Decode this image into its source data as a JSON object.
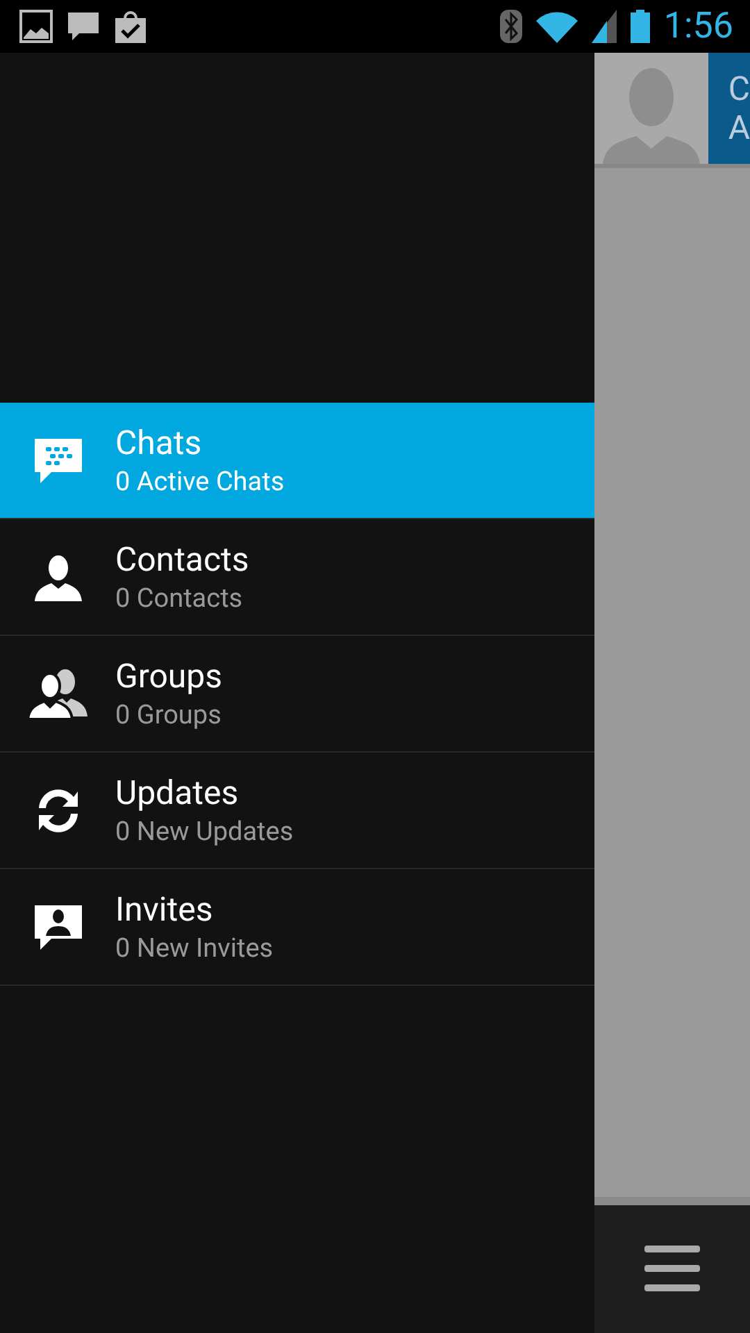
{
  "status_bar": {
    "time": "1:56"
  },
  "drawer": {
    "items": [
      {
        "kind": "chat",
        "title": "Chats",
        "subtitle": "0 Active Chats",
        "selected": true
      },
      {
        "kind": "contact",
        "title": "Contacts",
        "subtitle": "0 Contacts",
        "selected": false
      },
      {
        "kind": "group",
        "title": "Groups",
        "subtitle": "0 Groups",
        "selected": false
      },
      {
        "kind": "sync",
        "title": "Updates",
        "subtitle": "0 New Updates",
        "selected": false
      },
      {
        "kind": "invite",
        "title": "Invites",
        "subtitle": "0 New Invites",
        "selected": false
      }
    ]
  },
  "background_screen": {
    "header_line_1": "C",
    "header_line_2": "A"
  }
}
